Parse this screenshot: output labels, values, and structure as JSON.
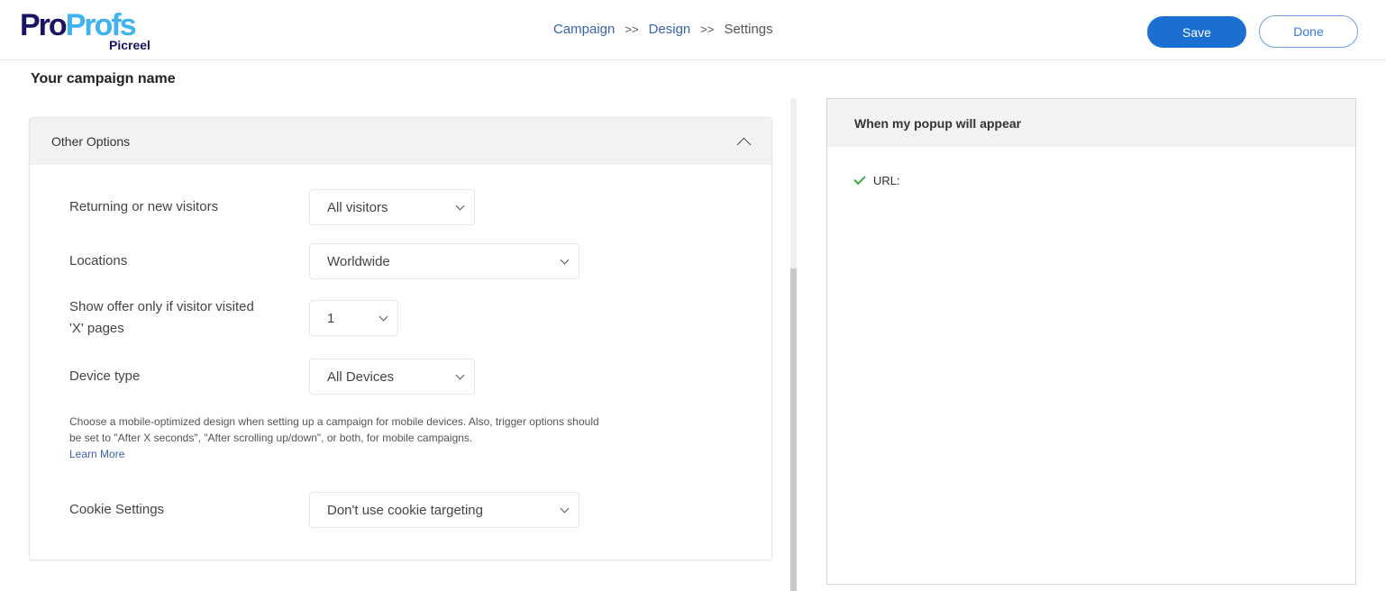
{
  "brand": {
    "name_part1": "Pro",
    "name_part2": "Profs",
    "product": "Picreel",
    "colors": {
      "dark": "#1a1464",
      "light": "#3eb3f0"
    }
  },
  "breadcrumb": [
    {
      "label": "Campaign",
      "link": true
    },
    {
      "label": ">>",
      "separator": true
    },
    {
      "label": "Design",
      "link": true
    },
    {
      "label": ">>",
      "separator": true
    },
    {
      "label": "Settings",
      "current": true
    }
  ],
  "header": {
    "save_label": "Save",
    "done_label": "Done",
    "accent": "#1a6fd1"
  },
  "campaign_name": "Your campaign name",
  "other_options": {
    "title": "Other Options",
    "expanded": true,
    "fields": [
      {
        "label": "Returning or new visitors",
        "value": "All visitors"
      },
      {
        "label": "Locations",
        "value": "Worldwide"
      },
      {
        "label": "Show offer only if visitor visited 'X' pages",
        "value": "1"
      },
      {
        "label": "Device type",
        "value": "All Devices"
      }
    ],
    "help_text": "Choose a mobile-optimized design when setting up a campaign for mobile devices. Also, trigger options should be set to \"After X seconds\", \"After scrolling up/down\", or both, for mobile campaigns.",
    "learn_more": "Learn More",
    "cookie": {
      "label": "Cookie Settings",
      "value": "Don't use cookie targeting"
    }
  },
  "summary": {
    "title": "When my popup will appear",
    "items": [
      {
        "icon": "check-icon",
        "label": "URL:"
      }
    ]
  }
}
